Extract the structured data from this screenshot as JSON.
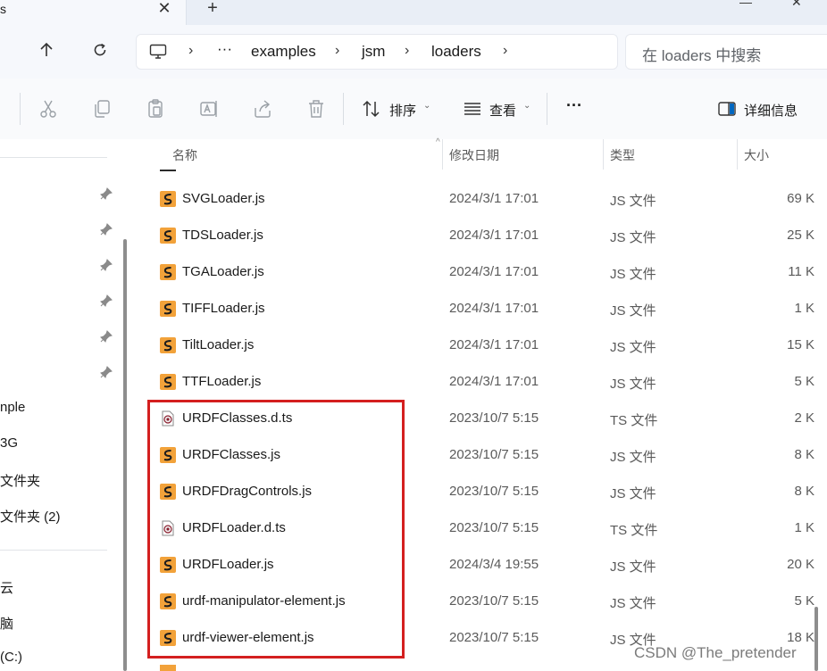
{
  "tab": {
    "title": "s",
    "close_glyph": "✕",
    "new_glyph": "+"
  },
  "window": {
    "min_glyph": "—",
    "close_glyph": "✕"
  },
  "nav": {
    "up_icon": "up-arrow-icon",
    "refresh_icon": "refresh-icon"
  },
  "breadcrumb": {
    "monitor_icon": "this-pc-icon",
    "sep": "›",
    "more": "···",
    "items": [
      "examples",
      "jsm",
      "loaders"
    ]
  },
  "search": {
    "placeholder": "在 loaders 中搜索"
  },
  "toolbar": {
    "sort_label": "排序",
    "view_label": "查看",
    "more_label": "···",
    "details_label": "详细信息",
    "caret": "⌄"
  },
  "columns": {
    "name": "名称",
    "modified": "修改日期",
    "type": "类型",
    "size": "大小",
    "sort_glyph": "^"
  },
  "navpane": {
    "items": [
      "nple",
      "3G",
      "文件夹",
      "文件夹 (2)",
      "云",
      "脑",
      "(C:)"
    ]
  },
  "files": [
    {
      "name": "SVGLoader.js",
      "date": "2024/3/1 17:01",
      "type": "JS 文件",
      "size": "69 K",
      "icon": "js-file-icon"
    },
    {
      "name": "TDSLoader.js",
      "date": "2024/3/1 17:01",
      "type": "JS 文件",
      "size": "25 K",
      "icon": "js-file-icon"
    },
    {
      "name": "TGALoader.js",
      "date": "2024/3/1 17:01",
      "type": "JS 文件",
      "size": "11 K",
      "icon": "js-file-icon"
    },
    {
      "name": "TIFFLoader.js",
      "date": "2024/3/1 17:01",
      "type": "JS 文件",
      "size": "1 K",
      "icon": "js-file-icon"
    },
    {
      "name": "TiltLoader.js",
      "date": "2024/3/1 17:01",
      "type": "JS 文件",
      "size": "15 K",
      "icon": "js-file-icon"
    },
    {
      "name": "TTFLoader.js",
      "date": "2024/3/1 17:01",
      "type": "JS 文件",
      "size": "5 K",
      "icon": "js-file-icon"
    },
    {
      "name": "URDFClasses.d.ts",
      "date": "2023/10/7 5:15",
      "type": "TS 文件",
      "size": "2 K",
      "icon": "ts-file-icon"
    },
    {
      "name": "URDFClasses.js",
      "date": "2023/10/7 5:15",
      "type": "JS 文件",
      "size": "8 K",
      "icon": "js-file-icon"
    },
    {
      "name": "URDFDragControls.js",
      "date": "2023/10/7 5:15",
      "type": "JS 文件",
      "size": "8 K",
      "icon": "js-file-icon"
    },
    {
      "name": "URDFLoader.d.ts",
      "date": "2023/10/7 5:15",
      "type": "TS 文件",
      "size": "1 K",
      "icon": "ts-file-icon"
    },
    {
      "name": "URDFLoader.js",
      "date": "2024/3/4 19:55",
      "type": "JS 文件",
      "size": "20 K",
      "icon": "js-file-icon"
    },
    {
      "name": "urdf-manipulator-element.js",
      "date": "2023/10/7 5:15",
      "type": "JS 文件",
      "size": "5 K",
      "icon": "js-file-icon"
    },
    {
      "name": "urdf-viewer-element.js",
      "date": "2023/10/7 5:15",
      "type": "JS 文件",
      "size": "18 K",
      "icon": "js-file-icon"
    }
  ],
  "watermark": "CSDN @The_pretender",
  "colors": {
    "js_icon": "#f2a23a",
    "highlight": "#d41f1f",
    "accent": "#0067c0"
  }
}
